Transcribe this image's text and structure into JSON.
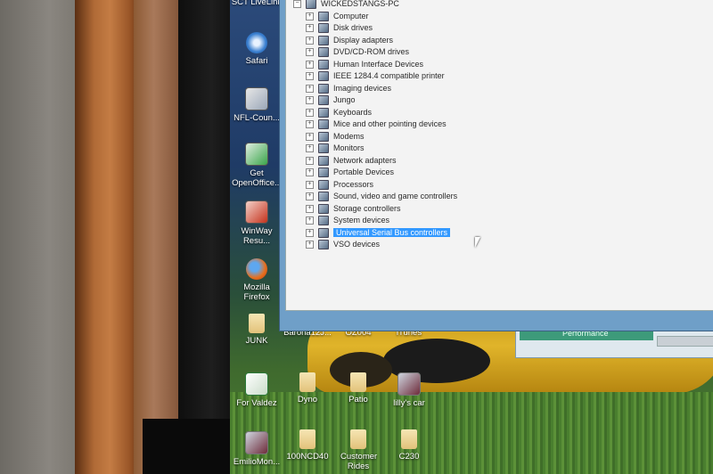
{
  "window": {
    "root_label": "WICKEDSTANGS-PC",
    "devices": [
      "Computer",
      "Disk drives",
      "Display adapters",
      "DVD/CD-ROM drives",
      "Human Interface Devices",
      "IEEE 1284.4 compatible printer",
      "Imaging devices",
      "Jungo",
      "Keyboards",
      "Mice and other pointing devices",
      "Modems",
      "Monitors",
      "Network adapters",
      "Portable Devices",
      "Processors",
      "Sound, video and game controllers",
      "Storage controllers",
      "System devices",
      "Universal Serial Bus controllers",
      "VSO devices"
    ],
    "selected": "Universal Serial Bus controllers"
  },
  "background_window": {
    "tab_label": "Performance"
  },
  "desktop_icons": {
    "top_partial": "SCT LiveLink",
    "safari": "Safari",
    "nfl": "NFL-Coun...",
    "openoffice": "Get OpenOffice...",
    "winway": "WinWay Resu...",
    "firefox": "Mozilla Firefox",
    "junk": "JUNK",
    "barona": "Barona12J...",
    "oz004": "OZ004",
    "itunes": "iTunes",
    "forvaldez": "For Valdez",
    "dyno": "Dyno",
    "patio": "Patio",
    "lillyscar": "lilly's car",
    "emilio": "EmilioMon...",
    "ncd": "100NCD40",
    "customer": "Customer Rides",
    "c230": "C230"
  }
}
